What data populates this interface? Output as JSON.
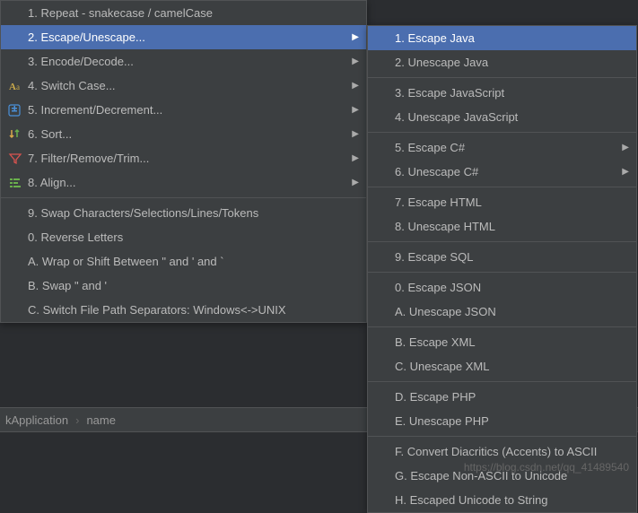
{
  "main_menu": {
    "items": [
      {
        "label": "1. Repeat - snakecase / camelCase",
        "icon": "",
        "arrow": false
      },
      {
        "label": "2. Escape/Unescape...",
        "icon": "",
        "arrow": true,
        "selected": true
      },
      {
        "label": "3. Encode/Decode...",
        "icon": "",
        "arrow": true
      },
      {
        "label": "4. Switch Case...",
        "icon": "switch-case",
        "arrow": true
      },
      {
        "label": "5. Increment/Decrement...",
        "icon": "increment",
        "arrow": true
      },
      {
        "label": "6. Sort...",
        "icon": "sort",
        "arrow": true
      },
      {
        "label": "7. Filter/Remove/Trim...",
        "icon": "filter",
        "arrow": true
      },
      {
        "label": "8. Align...",
        "icon": "align",
        "arrow": true
      },
      {
        "label": "9. Swap Characters/Selections/Lines/Tokens",
        "icon": "",
        "arrow": false
      },
      {
        "label": "0. Reverse Letters",
        "icon": "",
        "arrow": false
      },
      {
        "label": "A. Wrap or Shift Between \" and ' and `",
        "icon": "",
        "arrow": false
      },
      {
        "label": "B. Swap \" and '",
        "icon": "",
        "arrow": false
      },
      {
        "label": "C. Switch File Path Separators: Windows<->UNIX",
        "icon": "",
        "arrow": false
      }
    ],
    "dividers_after": [
      7
    ]
  },
  "sub_menu": {
    "items": [
      {
        "label": "1. Escape Java",
        "arrow": false,
        "selected": true
      },
      {
        "label": "2. Unescape Java",
        "arrow": false
      },
      {
        "label": "3. Escape JavaScript",
        "arrow": false
      },
      {
        "label": "4. Unescape JavaScript",
        "arrow": false
      },
      {
        "label": "5. Escape C#",
        "arrow": true
      },
      {
        "label": "6. Unescape C#",
        "arrow": true
      },
      {
        "label": "7. Escape HTML",
        "arrow": false
      },
      {
        "label": "8. Unescape HTML",
        "arrow": false
      },
      {
        "label": "9. Escape SQL",
        "arrow": false
      },
      {
        "label": "0. Escape JSON",
        "arrow": false
      },
      {
        "label": "A. Unescape JSON",
        "arrow": false
      },
      {
        "label": "B. Escape XML",
        "arrow": false
      },
      {
        "label": "C. Unescape XML",
        "arrow": false
      },
      {
        "label": "D. Escape PHP",
        "arrow": false
      },
      {
        "label": "E. Unescape PHP",
        "arrow": false
      },
      {
        "label": "F. Convert Diacritics (Accents) to ASCII",
        "arrow": false
      },
      {
        "label": "G. Escape Non-ASCII to Unicode",
        "arrow": false
      },
      {
        "label": "H. Escaped Unicode to String",
        "arrow": false
      }
    ],
    "dividers_after": [
      1,
      3,
      5,
      7,
      8,
      10,
      12,
      14
    ]
  },
  "breadcrumb": {
    "part1": "kApplication",
    "part2": "name"
  },
  "watermark": "https://blog.csdn.net/qq_41489540",
  "arrow_glyph": "▶"
}
